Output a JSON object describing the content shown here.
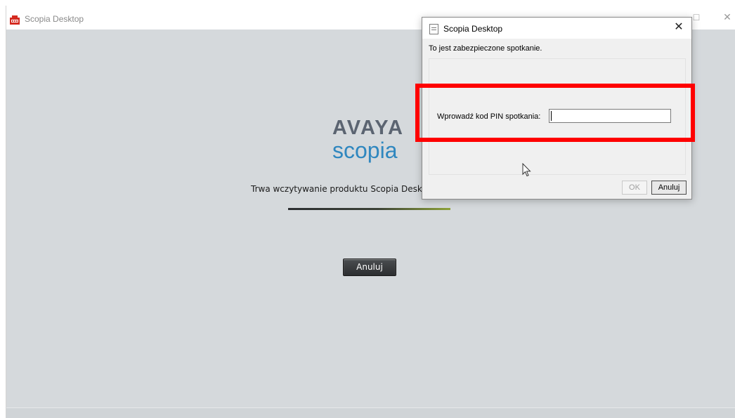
{
  "main_window": {
    "title": "Scopia Desktop",
    "logo_top": "AVAYA",
    "logo_bottom": "scopia",
    "loading_message": "Trwa wczytywanie produktu Scopia Desktop. Proszę czekać...",
    "progress": 1.0,
    "cancel_label": "Anuluj",
    "controls": {
      "maximize": "□",
      "close": "✕"
    }
  },
  "dialog": {
    "title": "Scopia Desktop",
    "close_glyph": "✕",
    "message": "To jest zabezpieczone spotkanie.",
    "pin_label": "Wprowadź kod PIN spotkania:",
    "pin_value": "",
    "pin_placeholder": "",
    "ok_label": "OK",
    "cancel_label": "Anuluj",
    "ok_enabled": false
  },
  "colors": {
    "client_background": "#d5d9dc",
    "logo_avaya": "#5b6471",
    "logo_scopia": "#2f87bf",
    "highlight": "#ff0000"
  },
  "icons": [
    "app-icon",
    "document-icon",
    "close-icon",
    "maximize-icon",
    "mouse-cursor-icon"
  ]
}
